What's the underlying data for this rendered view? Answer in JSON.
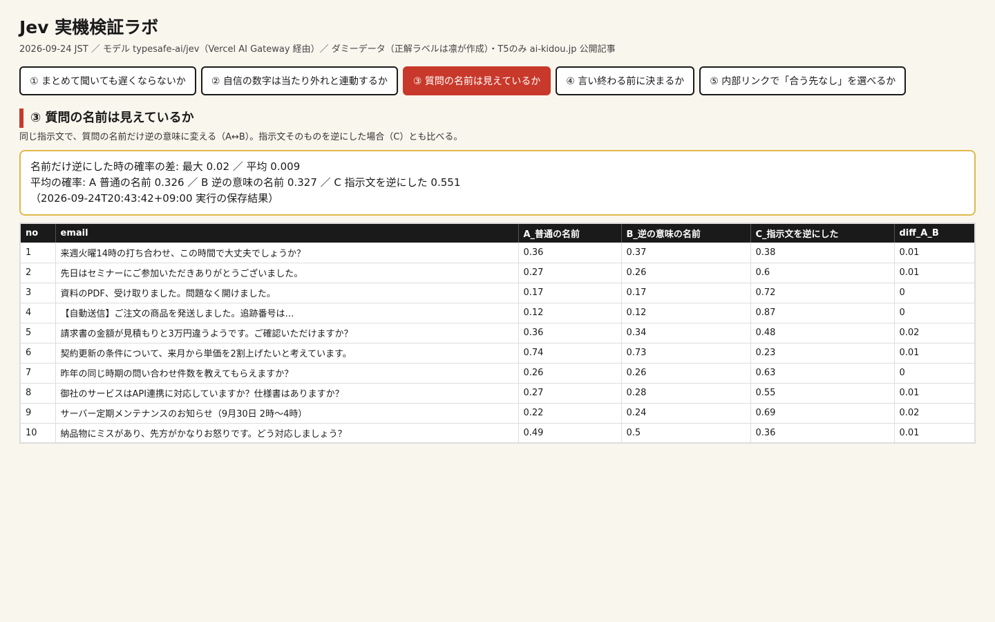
{
  "title": "Jev 実機検証ラボ",
  "subtitle": "2026-09-24 JST ／ モデル typesafe-ai/jev（Vercel AI Gateway 経由）／ ダミーデータ（正解ラベルは凛が作成）・T5のみ ai-kidou.jp 公開記事",
  "tabs": [
    {
      "label": "① まとめて聞いても遅くならないか",
      "active": false
    },
    {
      "label": "② 自信の数字は当たり外れと連動するか",
      "active": false
    },
    {
      "label": "③ 質問の名前は見えているか",
      "active": true
    },
    {
      "label": "④ 言い終わる前に決まるか",
      "active": false
    },
    {
      "label": "⑤ 内部リンクで「合う先なし」を選べるか",
      "active": false
    }
  ],
  "section": {
    "title": "③ 質問の名前は見えているか",
    "description": "同じ指示文で、質問の名前だけ逆の意味に変える（A↔B）。指示文そのものを逆にした場合（C）とも比べる。"
  },
  "summary": {
    "line1": "名前だけ逆にした時の確率の差: 最大 0.02 ／ 平均 0.009",
    "line2": "平均の確率: A 普通の名前 0.326 ／ B 逆の意味の名前 0.327 ／ C 指示文を逆にした 0.551",
    "line3": "（2026-09-24T20:43:42+09:00 実行の保存結果）"
  },
  "table": {
    "headers": [
      "no",
      "email",
      "A_普通の名前",
      "B_逆の意味の名前",
      "C_指示文を逆にした",
      "diff_A_B"
    ],
    "rows": [
      [
        "1",
        "来週火曜14時の打ち合わせ、この時間で大丈夫でしょうか？",
        "0.36",
        "0.37",
        "0.38",
        "0.01"
      ],
      [
        "2",
        "先日はセミナーにご参加いただきありがとうございました。",
        "0.27",
        "0.26",
        "0.6",
        "0.01"
      ],
      [
        "3",
        "資料のPDF、受け取りました。問題なく開けました。",
        "0.17",
        "0.17",
        "0.72",
        "0"
      ],
      [
        "4",
        "【自動送信】ご注文の商品を発送しました。追跡番号は…",
        "0.12",
        "0.12",
        "0.87",
        "0"
      ],
      [
        "5",
        "請求書の金額が見積もりと3万円違うようです。ご確認いただけますか？",
        "0.36",
        "0.34",
        "0.48",
        "0.02"
      ],
      [
        "6",
        "契約更新の条件について、来月から単価を2割上げたいと考えています。",
        "0.74",
        "0.73",
        "0.23",
        "0.01"
      ],
      [
        "7",
        "昨年の同じ時期の問い合わせ件数を教えてもらえますか？",
        "0.26",
        "0.26",
        "0.63",
        "0"
      ],
      [
        "8",
        "御社のサービスはAPI連携に対応していますか？仕様書はありますか？",
        "0.27",
        "0.28",
        "0.55",
        "0.01"
      ],
      [
        "9",
        "サーバー定期メンテナンスのお知らせ（9月30日 2時〜4時）",
        "0.22",
        "0.24",
        "0.69",
        "0.02"
      ],
      [
        "10",
        "納品物にミスがあり、先方がかなりお怒りです。どう対応しましょう？",
        "0.49",
        "0.5",
        "0.36",
        "0.01"
      ]
    ]
  },
  "colors": {
    "background": "#f9f6ee",
    "accent": "#c8392b",
    "summary_border": "#e0b84a",
    "table_header": "#1a1a1a"
  }
}
